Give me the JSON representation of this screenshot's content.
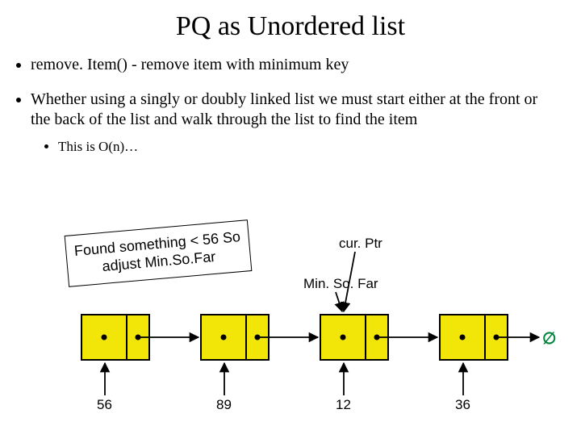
{
  "title": "PQ as Unordered list",
  "bullets": {
    "b1": "remove. Item() - remove item with minimum key",
    "b2": "Whether using a singly or doubly linked list we must start either at the front or the back of the list and walk through the list to find the item",
    "b2_sub": "This is O(n)…"
  },
  "callout": "Found something < 56\nSo adjust Min.So.Far",
  "pointers": {
    "curPtr": "cur. Ptr",
    "minSoFar": "Min. So. Far"
  },
  "null_symbol": "∅",
  "nodes": {
    "n0": "56",
    "n1": "89",
    "n2": "12",
    "n3": "36"
  }
}
